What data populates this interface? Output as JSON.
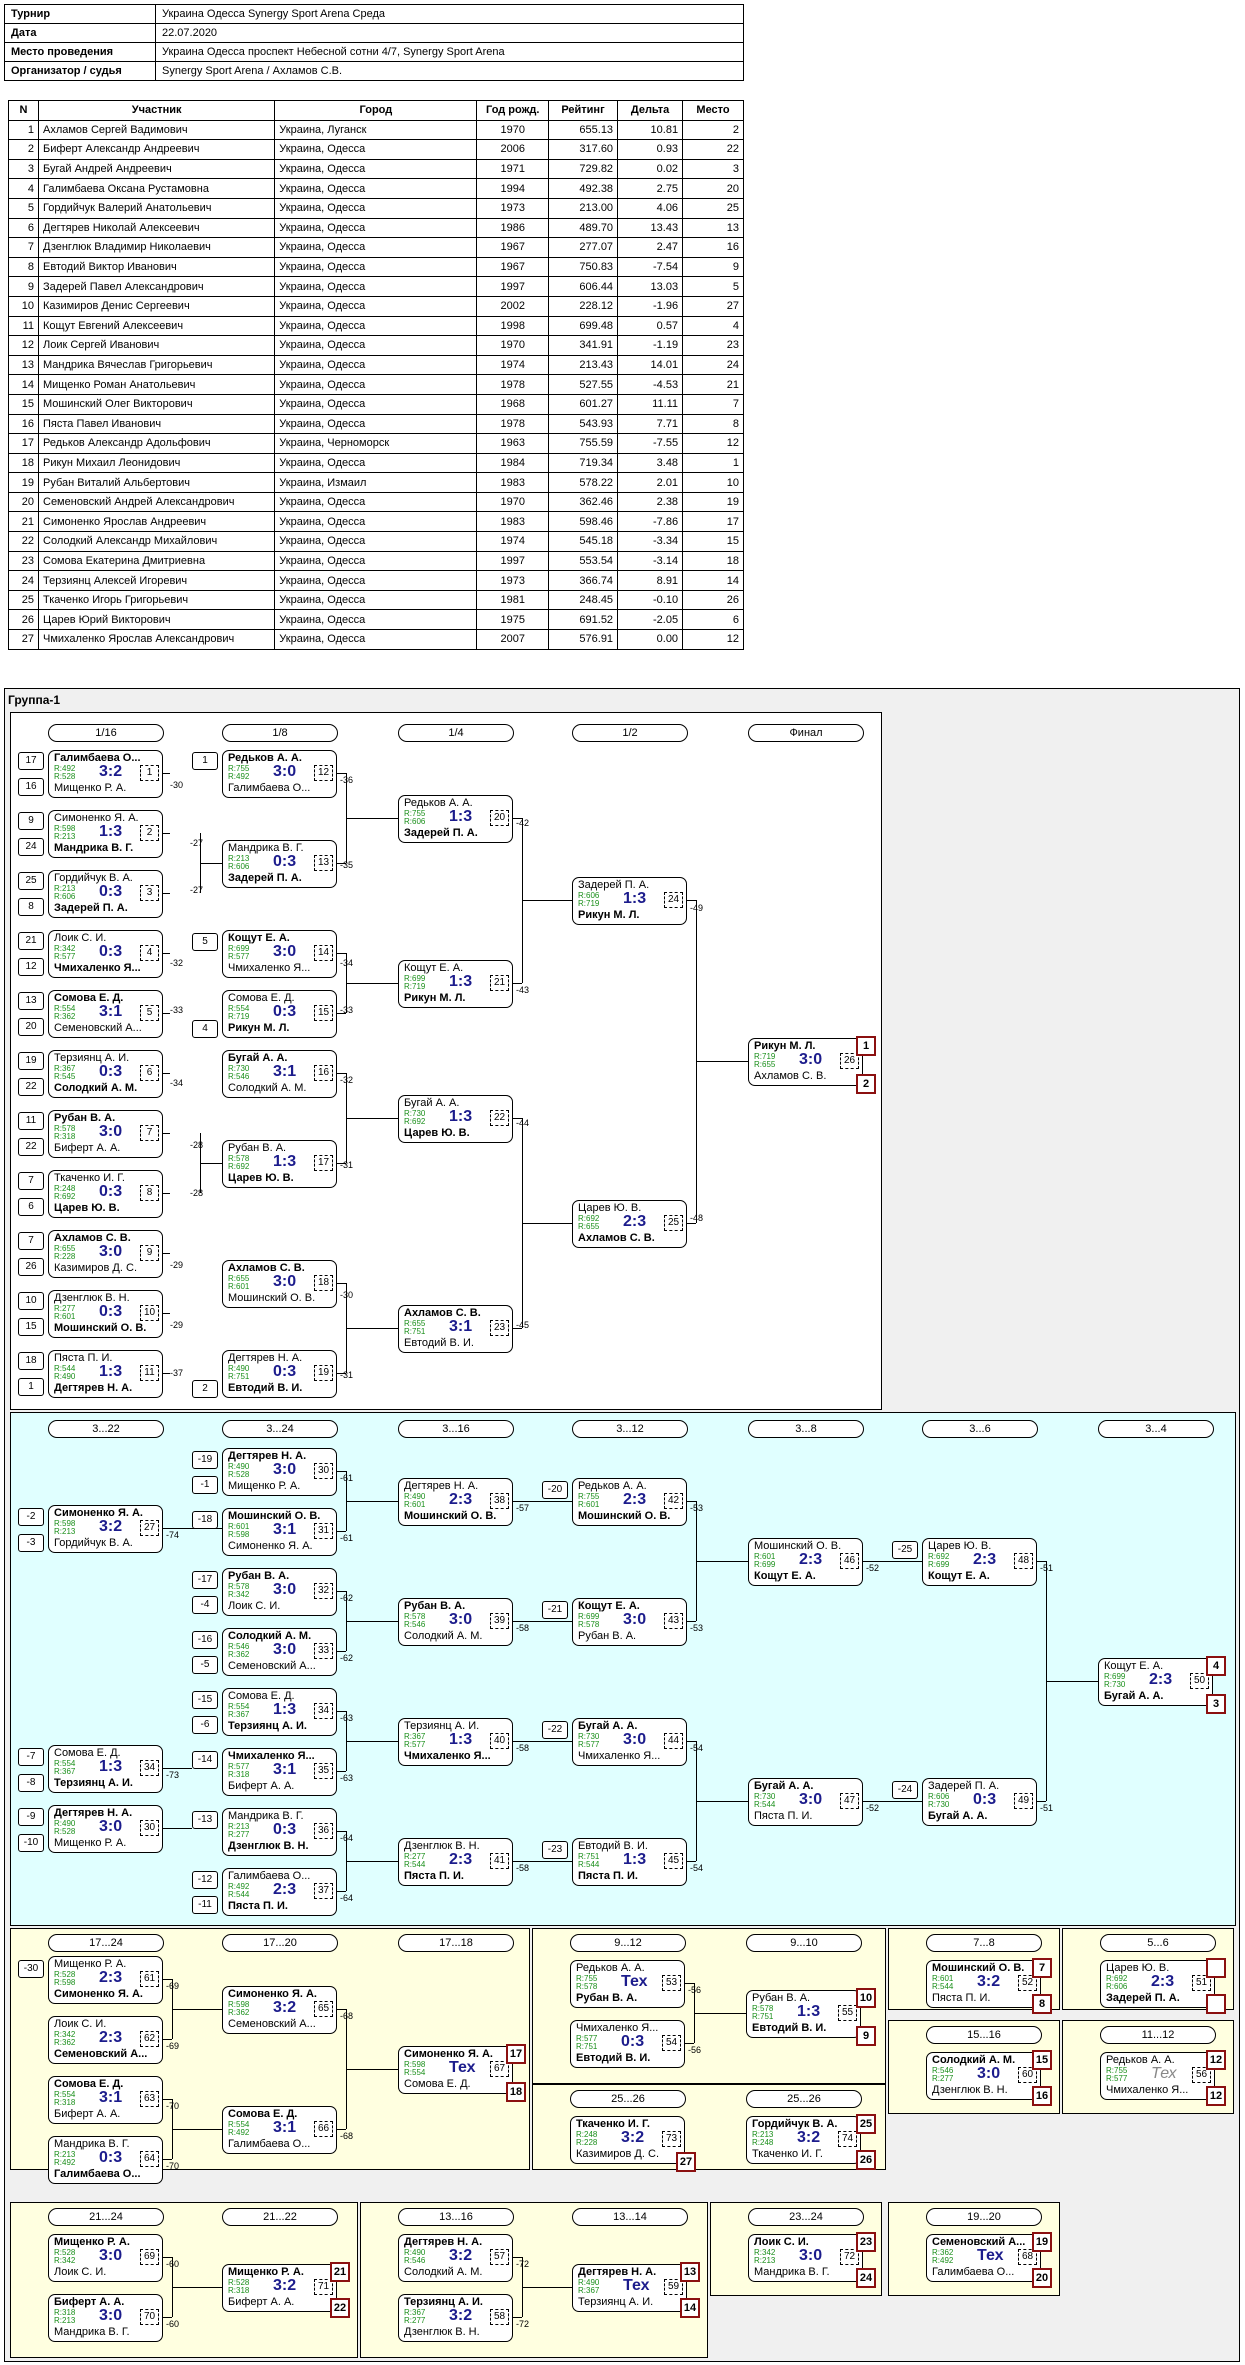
{
  "info": [
    {
      "key": "Турнир",
      "value": "Украина Одесса Synergy Sport Arena Среда"
    },
    {
      "key": "Дата",
      "value": "22.07.2020"
    },
    {
      "key": "Место проведения",
      "value": "Украина Одесса проспект Небесной сотни 4/7, Synergy Sport Arena"
    },
    {
      "key": "Организатор / судья",
      "value": "Synergy Sport Arena / Ахламов С.В."
    }
  ],
  "players_headers": [
    "N",
    "Участник",
    "Город",
    "Год рожд.",
    "Рейтинг",
    "Дельта",
    "Место"
  ],
  "players": [
    [
      "1",
      "Ахламов Сергей Вадимович",
      "Украина, Луганск",
      "1970",
      "655.13",
      "10.81",
      "2"
    ],
    [
      "2",
      "Биферт Александр Андреевич",
      "Украина, Одесса",
      "2006",
      "317.60",
      "0.93",
      "22"
    ],
    [
      "3",
      "Бугай Андрей Андреевич",
      "Украина, Одесса",
      "1971",
      "729.82",
      "0.02",
      "3"
    ],
    [
      "4",
      "Галимбаева Оксана Рустамовна",
      "Украина, Одесса",
      "1994",
      "492.38",
      "2.75",
      "20"
    ],
    [
      "5",
      "Гордийчук Валерий Анатольевич",
      "Украина, Одесса",
      "1973",
      "213.00",
      "4.06",
      "25"
    ],
    [
      "6",
      "Дегтярев Николай Алексеевич",
      "Украина, Одесса",
      "1986",
      "489.70",
      "13.43",
      "13"
    ],
    [
      "7",
      "Дзенглюк Владимир Николаевич",
      "Украина, Одесса",
      "1967",
      "277.07",
      "2.47",
      "16"
    ],
    [
      "8",
      "Евтодий Виктор Иванович",
      "Украина, Одесса",
      "1967",
      "750.83",
      "-7.54",
      "9"
    ],
    [
      "9",
      "Задерей Павел Александрович",
      "Украина, Одесса",
      "1997",
      "606.44",
      "13.03",
      "5"
    ],
    [
      "10",
      "Казимиров Денис Сергеевич",
      "Украина, Одесса",
      "2002",
      "228.12",
      "-1.96",
      "27"
    ],
    [
      "11",
      "Кощут Евгений Алексеевич",
      "Украина, Одесса",
      "1998",
      "699.48",
      "0.57",
      "4"
    ],
    [
      "12",
      "Лоик Сергей Иванович",
      "Украина, Одесса",
      "1970",
      "341.91",
      "-1.19",
      "23"
    ],
    [
      "13",
      "Мандрика Вячеслав Григорьевич",
      "Украина, Одесса",
      "1974",
      "213.43",
      "14.01",
      "24"
    ],
    [
      "14",
      "Мищенко Роман Анатольевич",
      "Украина, Одесса",
      "1978",
      "527.55",
      "-4.53",
      "21"
    ],
    [
      "15",
      "Мошинский Олег Викторович",
      "Украина, Одесса",
      "1968",
      "601.27",
      "11.11",
      "7"
    ],
    [
      "16",
      "Пяста Павел Иванович",
      "Украина, Одесса",
      "1978",
      "543.93",
      "7.71",
      "8"
    ],
    [
      "17",
      "Редьков Александр Адольфович",
      "Украина, Черноморск",
      "1963",
      "755.59",
      "-7.55",
      "12"
    ],
    [
      "18",
      "Рикун Михаил Леонидович",
      "Украина, Одесса",
      "1984",
      "719.34",
      "3.48",
      "1"
    ],
    [
      "19",
      "Рубан Виталий Альбертович",
      "Украина, Измаил",
      "1983",
      "578.22",
      "2.01",
      "10"
    ],
    [
      "20",
      "Семеновский Андрей Александрович",
      "Украина, Одесса",
      "1970",
      "362.46",
      "2.38",
      "19"
    ],
    [
      "21",
      "Симоненко Ярослав Андреевич",
      "Украина, Одесса",
      "1983",
      "598.46",
      "-7.86",
      "17"
    ],
    [
      "22",
      "Солодкий Александр Михайлович",
      "Украина, Одесса",
      "1974",
      "545.18",
      "-3.34",
      "15"
    ],
    [
      "23",
      "Сомова Екатерина Дмитриевна",
      "Украина, Одесса",
      "1997",
      "553.54",
      "-3.14",
      "18"
    ],
    [
      "24",
      "Терзиянц Алексей Игоревич",
      "Украина, Одесса",
      "1973",
      "366.74",
      "8.91",
      "14"
    ],
    [
      "25",
      "Ткаченко Игорь Григорьевич",
      "Украина, Одесса",
      "1981",
      "248.45",
      "-0.10",
      "26"
    ],
    [
      "26",
      "Царев Юрий Викторович",
      "Украина, Одесса",
      "1975",
      "691.52",
      "-2.05",
      "6"
    ],
    [
      "27",
      "Чмихаленко Ярослав Александрович",
      "Украина, Одесса",
      "2007",
      "576.91",
      "0.00",
      "12"
    ]
  ],
  "group_title": "Группа-1",
  "round_labels": {
    "main": [
      "1/16",
      "1/8",
      "1/4",
      "1/2",
      "Финал"
    ],
    "cons": [
      "3...22",
      "3...24",
      "3...16",
      "3...12",
      "3...8",
      "3...6",
      "3...4"
    ],
    "c1": [
      "17...24",
      "17...20",
      "17...18"
    ],
    "c2": [
      "9...12",
      "9...10"
    ],
    "c3": [
      "7...8"
    ],
    "c4": [
      "5...6"
    ],
    "c5": [
      "15...16"
    ],
    "c6": [
      "11...12"
    ],
    "c7": [
      "25...26",
      "25...26"
    ],
    "c8": [
      "21...24",
      "21...22"
    ],
    "c9": [
      "13...16",
      "13...14"
    ],
    "c10": [
      "23...24"
    ],
    "c11": [
      "19...20"
    ]
  },
  "matches": [
    {
      "p1": "Галимбаева О...",
      "r1": "R:492",
      "r2": "R:528",
      "p2": "Мищенко Р. А.",
      "s": "3:2",
      "n": "1",
      "w": 1
    },
    {
      "p1": "Симоненко Я. А.",
      "r1": "R:598",
      "r2": "R:213",
      "p2": "Мандрика В. Г.",
      "s": "1:3",
      "n": "2",
      "w": 2
    },
    {
      "p1": "Гордийчук В. А.",
      "r1": "R:213",
      "r2": "R:606",
      "p2": "Задерей П. А.",
      "s": "0:3",
      "n": "3",
      "w": 2
    },
    {
      "p1": "Лоик С. И.",
      "r1": "R:342",
      "r2": "R:577",
      "p2": "Чмихаленко Я...",
      "s": "0:3",
      "n": "4",
      "w": 2
    },
    {
      "p1": "Сомова Е. Д.",
      "r1": "R:554",
      "r2": "R:362",
      "p2": "Семеновский А...",
      "s": "3:1",
      "n": "5",
      "w": 1
    },
    {
      "p1": "Терзиянц А. И.",
      "r1": "R:367",
      "r2": "R:545",
      "p2": "Солодкий А. М.",
      "s": "0:3",
      "n": "6",
      "w": 2
    },
    {
      "p1": "Рубан В. А.",
      "r1": "R:578",
      "r2": "R:318",
      "p2": "Биферт А. А.",
      "s": "3:0",
      "n": "7",
      "w": 1
    },
    {
      "p1": "Ткаченко И. Г.",
      "r1": "R:248",
      "r2": "R:692",
      "p2": "Царев Ю. В.",
      "s": "0:3",
      "n": "8",
      "w": 2
    },
    {
      "p1": "Ахламов С. В.",
      "r1": "R:655",
      "r2": "R:228",
      "p2": "Казимиров Д. С.",
      "s": "3:0",
      "n": "9",
      "w": 1
    },
    {
      "p1": "Дзенглюк В. Н.",
      "r1": "R:277",
      "r2": "R:601",
      "p2": "Мошинский О. В.",
      "s": "0:3",
      "n": "10",
      "w": 2
    },
    {
      "p1": "Пяста П. И.",
      "r1": "R:544",
      "r2": "R:490",
      "p2": "Дегтярев Н. А.",
      "s": "1:3",
      "n": "11",
      "w": 2
    },
    {
      "p1": "Редьков А. А.",
      "r1": "R:755",
      "r2": "R:492",
      "p2": "Галимбаева О...",
      "s": "3:0",
      "n": "12",
      "w": 1
    },
    {
      "p1": "Мандрика В. Г.",
      "r1": "R:213",
      "r2": "R:606",
      "p2": "Задерей П. А.",
      "s": "0:3",
      "n": "13",
      "w": 2
    },
    {
      "p1": "Кощут Е. А.",
      "r1": "R:699",
      "r2": "R:577",
      "p2": "Чмихаленко Я...",
      "s": "3:0",
      "n": "14",
      "w": 1
    },
    {
      "p1": "Сомова Е. Д.",
      "r1": "R:554",
      "r2": "R:719",
      "p2": "Рикун М. Л.",
      "s": "0:3",
      "n": "15",
      "w": 2
    },
    {
      "p1": "Бугай А. А.",
      "r1": "R:730",
      "r2": "R:546",
      "p2": "Солодкий А. М.",
      "s": "3:1",
      "n": "16",
      "w": 1
    },
    {
      "p1": "Рубан В. А.",
      "r1": "R:578",
      "r2": "R:692",
      "p2": "Царев Ю. В.",
      "s": "1:3",
      "n": "17",
      "w": 2
    },
    {
      "p1": "Ахламов С. В.",
      "r1": "R:655",
      "r2": "R:601",
      "p2": "Мошинский О. В.",
      "s": "3:0",
      "n": "18",
      "w": 1
    },
    {
      "p1": "Дегтярев Н. А.",
      "r1": "R:490",
      "r2": "R:751",
      "p2": "Евтодий В. И.",
      "s": "0:3",
      "n": "19",
      "w": 2
    },
    {
      "p1": "Редьков А. А.",
      "r1": "R:755",
      "r2": "R:606",
      "p2": "Задерей П. А.",
      "s": "1:3",
      "n": "20",
      "w": 2
    },
    {
      "p1": "Кощут Е. А.",
      "r1": "R:699",
      "r2": "R:719",
      "p2": "Рикун М. Л.",
      "s": "1:3",
      "n": "21",
      "w": 2
    },
    {
      "p1": "Бугай А. А.",
      "r1": "R:730",
      "r2": "R:692",
      "p2": "Царев Ю. В.",
      "s": "1:3",
      "n": "22",
      "w": 2
    },
    {
      "p1": "Ахламов С. В.",
      "r1": "R:655",
      "r2": "R:751",
      "p2": "Евтодий В. И.",
      "s": "3:1",
      "n": "23",
      "w": 1
    },
    {
      "p1": "Задерей П. А.",
      "r1": "R:606",
      "r2": "R:719",
      "p2": "Рикун М. Л.",
      "s": "1:3",
      "n": "24",
      "w": 2
    },
    {
      "p1": "Царев Ю. В.",
      "r1": "R:692",
      "r2": "R:655",
      "p2": "Ахламов С. В.",
      "s": "2:3",
      "n": "25",
      "w": 2
    },
    {
      "p1": "Рикун М. Л.",
      "r1": "R:719",
      "r2": "R:655",
      "p2": "Ахламов С. В.",
      "s": "3:0",
      "n": "26",
      "w": 1
    },
    {
      "p1": "Симоненко Я. А.",
      "r1": "R:598",
      "r2": "R:213",
      "p2": "Гордийчук В. А.",
      "s": "3:2",
      "n": "27",
      "w": 1
    },
    {
      "p1": "Дегтярев Н. А.",
      "r1": "R:490",
      "r2": "R:528",
      "p2": "Мищенко Р. А.",
      "s": "3:0",
      "n": "30",
      "w": 1
    },
    {
      "p1": "Мошинский О. В.",
      "r1": "R:601",
      "r2": "R:598",
      "p2": "Симоненко Я. А.",
      "s": "3:1",
      "n": "31",
      "w": 1
    },
    {
      "p1": "Рубан В. А.",
      "r1": "R:578",
      "r2": "R:342",
      "p2": "Лоик С. И.",
      "s": "3:0",
      "n": "32",
      "w": 1
    },
    {
      "p1": "Солодкий А. М.",
      "r1": "R:546",
      "r2": "R:362",
      "p2": "Семеновский А...",
      "s": "3:0",
      "n": "33",
      "w": 1
    },
    {
      "p1": "Сомова Е. Д.",
      "r1": "R:554",
      "r2": "R:367",
      "p2": "Терзиянц А. И.",
      "s": "1:3",
      "n": "34",
      "w": 2
    },
    {
      "p1": "Чмихаленко Я...",
      "r1": "R:577",
      "r2": "R:318",
      "p2": "Биферт А. А.",
      "s": "3:1",
      "n": "35",
      "w": 1
    },
    {
      "p1": "Мандрика В. Г.",
      "r1": "R:213",
      "r2": "R:277",
      "p2": "Дзенглюк В. Н.",
      "s": "0:3",
      "n": "36",
      "w": 2
    },
    {
      "p1": "Галимбаева О...",
      "r1": "R:492",
      "r2": "R:544",
      "p2": "Пяста П. И.",
      "s": "2:3",
      "n": "37",
      "w": 2
    },
    {
      "p1": "Дегтярев Н. А.",
      "r1": "R:490",
      "r2": "R:601",
      "p2": "Мошинский О. В.",
      "s": "2:3",
      "n": "38",
      "w": 2
    },
    {
      "p1": "Рубан В. А.",
      "r1": "R:578",
      "r2": "R:546",
      "p2": "Солодкий А. М.",
      "s": "3:0",
      "n": "39",
      "w": 1
    },
    {
      "p1": "Терзиянц А. И.",
      "r1": "R:367",
      "r2": "R:577",
      "p2": "Чмихаленко Я...",
      "s": "1:3",
      "n": "40",
      "w": 2
    },
    {
      "p1": "Дзенглюк В. Н.",
      "r1": "R:277",
      "r2": "R:544",
      "p2": "Пяста П. И.",
      "s": "2:3",
      "n": "41",
      "w": 2
    },
    {
      "p1": "Редьков А. А.",
      "r1": "R:755",
      "r2": "R:601",
      "p2": "Мошинский О. В.",
      "s": "2:3",
      "n": "42",
      "w": 2
    },
    {
      "p1": "Кощут Е. А.",
      "r1": "R:699",
      "r2": "R:578",
      "p2": "Рубан В. А.",
      "s": "3:0",
      "n": "43",
      "w": 1
    },
    {
      "p1": "Бугай А. А.",
      "r1": "R:730",
      "r2": "R:577",
      "p2": "Чмихаленко Я...",
      "s": "3:0",
      "n": "44",
      "w": 1
    },
    {
      "p1": "Евтодий В. И.",
      "r1": "R:751",
      "r2": "R:544",
      "p2": "Пяста П. И.",
      "s": "1:3",
      "n": "45",
      "w": 2
    },
    {
      "p1": "Мошинский О. В.",
      "r1": "R:601",
      "r2": "R:699",
      "p2": "Кощут Е. А.",
      "s": "2:3",
      "n": "46",
      "w": 2
    },
    {
      "p1": "Бугай А. А.",
      "r1": "R:730",
      "r2": "R:544",
      "p2": "Пяста П. И.",
      "s": "3:0",
      "n": "47",
      "w": 1
    },
    {
      "p1": "Царев Ю. В.",
      "r1": "R:692",
      "r2": "R:699",
      "p2": "Кощут Е. А.",
      "s": "2:3",
      "n": "48",
      "w": 2
    },
    {
      "p1": "Задерей П. А.",
      "r1": "R:606",
      "r2": "R:730",
      "p2": "Бугай А. А.",
      "s": "0:3",
      "n": "49",
      "w": 2
    },
    {
      "p1": "Кощут Е. А.",
      "r1": "R:699",
      "r2": "R:730",
      "p2": "Бугай А. А.",
      "s": "2:3",
      "n": "50",
      "w": 2
    },
    {
      "p1": "Мищенко Р. А.",
      "r1": "R:528",
      "r2": "R:598",
      "p2": "Симоненко Я. А.",
      "s": "2:3",
      "n": "61",
      "w": 2
    },
    {
      "p1": "Лоик С. И.",
      "r1": "R:342",
      "r2": "R:362",
      "p2": "Семеновский А...",
      "s": "2:3",
      "n": "62",
      "w": 2
    },
    {
      "p1": "Сомова Е. Д.",
      "r1": "R:554",
      "r2": "R:318",
      "p2": "Биферт А. А.",
      "s": "3:1",
      "n": "63",
      "w": 1
    },
    {
      "p1": "Мандрика В. Г.",
      "r1": "R:213",
      "r2": "R:492",
      "p2": "Галимбаева О...",
      "s": "0:3",
      "n": "64",
      "w": 2
    },
    {
      "p1": "Симоненко Я. А.",
      "r1": "R:598",
      "r2": "R:362",
      "p2": "Семеновский А...",
      "s": "3:2",
      "n": "65",
      "w": 1
    },
    {
      "p1": "Сомова Е. Д.",
      "r1": "R:554",
      "r2": "R:492",
      "p2": "Галимбаева О...",
      "s": "3:1",
      "n": "66",
      "w": 1
    },
    {
      "p1": "Симоненко Я. А.",
      "r1": "R:598",
      "r2": "R:554",
      "p2": "Сомова Е. Д.",
      "s": "Тех",
      "n": "67",
      "w": 1
    },
    {
      "p1": "Редьков А. А.",
      "r1": "R:755",
      "r2": "R:578",
      "p2": "Рубан В. А.",
      "s": "Тех",
      "n": "53",
      "w": 2
    },
    {
      "p1": "Чмихаленко Я...",
      "r1": "R:577",
      "r2": "R:751",
      "p2": "Евтодий В. И.",
      "s": "0:3",
      "n": "54",
      "w": 2
    },
    {
      "p1": "Рубан В. А.",
      "r1": "R:578",
      "r2": "R:751",
      "p2": "Евтодий В. И.",
      "s": "1:3",
      "n": "55",
      "w": 2
    },
    {
      "p1": "Мошинский О. В.",
      "r1": "R:601",
      "r2": "R:544",
      "p2": "Пяста П. И.",
      "s": "3:2",
      "n": "52",
      "w": 1
    },
    {
      "p1": "Царев Ю. В.",
      "r1": "R:692",
      "r2": "R:606",
      "p2": "Задерей П. А.",
      "s": "2:3",
      "n": "51",
      "w": 2
    },
    {
      "p1": "Солодкий А. М.",
      "r1": "R:546",
      "r2": "R:277",
      "p2": "Дзенглюк В. Н.",
      "s": "3:0",
      "n": "60",
      "w": 1
    },
    {
      "p1": "Редьков А. А.",
      "r1": "R:755",
      "r2": "R:577",
      "p2": "Чмихаленко Я...",
      "s": "Тех",
      "n": "56",
      "w": 0
    },
    {
      "p1": "Ткаченко И. Г.",
      "r1": "R:248",
      "r2": "R:228",
      "p2": "Казимиров Д. С.",
      "s": "3:2",
      "n": "73",
      "w": 1
    },
    {
      "p1": "Гордийчук В. А.",
      "r1": "R:213",
      "r2": "R:248",
      "p2": "Ткаченко И. Г.",
      "s": "3:2",
      "n": "74",
      "w": 1
    },
    {
      "p1": "Мищенко Р. А.",
      "r1": "R:528",
      "r2": "R:342",
      "p2": "Лоик С. И.",
      "s": "3:0",
      "n": "69",
      "w": 1
    },
    {
      "p1": "Биферт А. А.",
      "r1": "R:318",
      "r2": "R:213",
      "p2": "Мандрика В. Г.",
      "s": "3:0",
      "n": "70",
      "w": 1
    },
    {
      "p1": "Мищенко Р. А.",
      "r1": "R:528",
      "r2": "R:318",
      "p2": "Биферт А. А.",
      "s": "3:2",
      "n": "71",
      "w": 1
    },
    {
      "p1": "Дегтярев Н. А.",
      "r1": "R:490",
      "r2": "R:546",
      "p2": "Солодкий А. М.",
      "s": "3:2",
      "n": "57",
      "w": 1
    },
    {
      "p1": "Терзиянц А. И.",
      "r1": "R:367",
      "r2": "R:277",
      "p2": "Дзенглюк В. Н.",
      "s": "3:2",
      "n": "58",
      "w": 1
    },
    {
      "p1": "Дегтярев Н. А.",
      "r1": "R:490",
      "r2": "R:367",
      "p2": "Терзиянц А. И.",
      "s": "Тех",
      "n": "59",
      "w": 1
    },
    {
      "p1": "Лоик С. И.",
      "r1": "R:342",
      "r2": "R:213",
      "p2": "Мандрика В. Г.",
      "s": "3:0",
      "n": "72",
      "w": 1
    },
    {
      "p1": "Семеновский А...",
      "r1": "R:362",
      "r2": "R:492",
      "p2": "Галимбаева О...",
      "s": "Тех",
      "n": "68",
      "w": 1
    }
  ],
  "seeds": [
    "17",
    "16",
    "9",
    "24",
    "25",
    "8",
    "21",
    "12",
    "13",
    "20",
    "19",
    "22",
    "11",
    "22",
    "7",
    "6",
    "7",
    "26",
    "10",
    "15",
    "18",
    "1",
    "5",
    "4",
    "3",
    "14",
    "23",
    "2"
  ],
  "cons_seeds": [
    "-19",
    "-1",
    "-18",
    "-2",
    "-3",
    "-17",
    "-4",
    "-16",
    "-5",
    "-15",
    "-6",
    "-14",
    "-7",
    "-8",
    "-13",
    "-9",
    "-10",
    "-12",
    "-11",
    "-20",
    "-21",
    "-22",
    "-23",
    "-25",
    "-24"
  ],
  "links": [
    "-30",
    "-27",
    "-27",
    "-32",
    "-33",
    "-34",
    "-28",
    "-28",
    "-29",
    "-29",
    "-37",
    "-37",
    "-36",
    "-35",
    "-34",
    "-33",
    "-32",
    "-31",
    "-30",
    "-42",
    "-43",
    "-44",
    "-45",
    "-49",
    "-48",
    "-74",
    "-61",
    "-61",
    "-62",
    "-62",
    "-63",
    "-63",
    "-73",
    "-64",
    "-64",
    "-57",
    "-57",
    "-58",
    "-58",
    "-53",
    "-53",
    "-54",
    "-54",
    "-52",
    "-52",
    "-51",
    "-51",
    "-69",
    "-69",
    "-70",
    "-70",
    "-68",
    "-68",
    "-56",
    "-56",
    "-60",
    "-60",
    "-72",
    "-72"
  ],
  "places": {
    "final": [
      "1",
      "2"
    ],
    "cons_final": [
      "4",
      "3"
    ],
    "c17": [
      "17",
      "18"
    ],
    "c9": [
      "10",
      "9"
    ],
    "c7": [
      "7",
      "8"
    ],
    "c5": [
      "6",
      "5"
    ],
    "c15": [
      "15",
      "16"
    ],
    "c11": [
      "12",
      "12"
    ],
    "c25": [
      "25",
      "26",
      "27"
    ],
    "c21": [
      "21",
      "22"
    ],
    "c13": [
      "13",
      "14"
    ],
    "c23": [
      "23",
      "24"
    ],
    "c19": [
      "19",
      "20"
    ]
  }
}
